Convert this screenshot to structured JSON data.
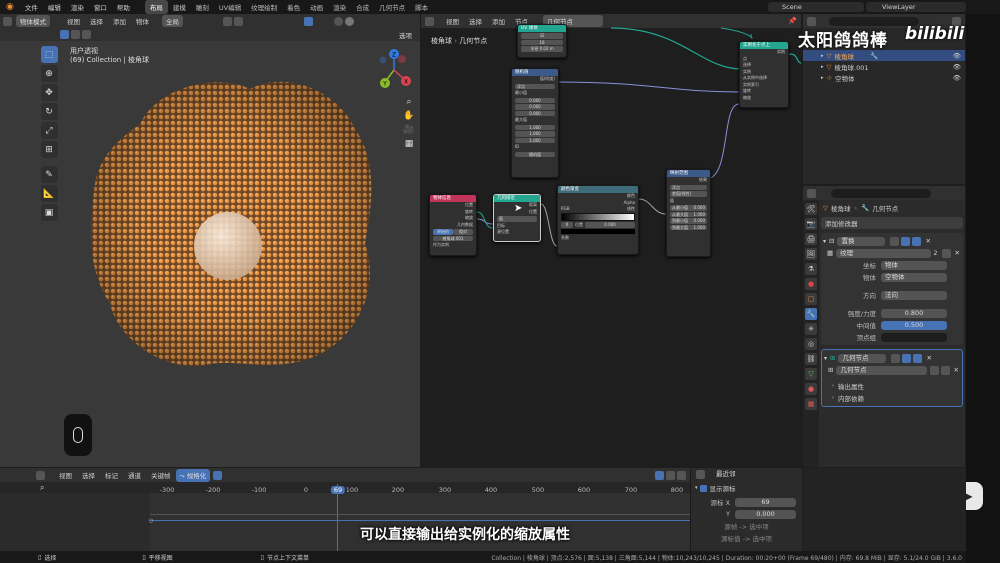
{
  "topbar": {
    "menus": [
      "文件",
      "编辑",
      "渲染",
      "窗口",
      "帮助"
    ],
    "workspaces": [
      "布局",
      "建模",
      "雕刻",
      "UV编辑",
      "纹理绘制",
      "着色",
      "动画",
      "渲染",
      "合成",
      "几何节点",
      "脚本"
    ],
    "active_workspace": "布局",
    "scene": "Scene",
    "view_layer": "ViewLayer"
  },
  "viewport": {
    "mode": "物体模式",
    "menus": [
      "视图",
      "选择",
      "添加",
      "物体"
    ],
    "orientation": "全局",
    "options": "选项",
    "view_title": "用户透视",
    "collection_line": "(69) Collection | 棱角球",
    "gizmo_axes": [
      "Y",
      "Z",
      "X"
    ]
  },
  "node_editor": {
    "menus": [
      "视图",
      "选择",
      "添加",
      "节点"
    ],
    "tree_name": "几何节点",
    "breadcrumb": [
      "棱角球",
      "几何节点"
    ],
    "nodes": {
      "uv": {
        "title": "UV 球体",
        "fields": [
          "32",
          "16",
          "半径  0.02 m"
        ]
      },
      "instance": {
        "title": "实例化于点上",
        "rows": [
          "实例",
          "点",
          "选择",
          "实例",
          "从实例中选择",
          "实例索引",
          "旋转",
          "缩放"
        ]
      },
      "random": {
        "title": "随机值",
        "rows": [
          "值(明度)",
          "浮点",
          "最小值",
          "最大值",
          "ID",
          "种子"
        ],
        "fields": [
          "0.000",
          "0.000",
          "0.000",
          "1.000",
          "1.000",
          "1.000",
          "随机值"
        ]
      },
      "objinfo": {
        "title": "物体信息",
        "rows": [
          "位置",
          "旋转",
          "缩放",
          "几何数据"
        ],
        "toggle": [
          "原始的",
          "相对"
        ],
        "object": "棱角球.001",
        "asinst": "作为实例"
      },
      "distribute": {
        "title": "几何接近",
        "rows": [
          "距离",
          "位置",
          "源",
          "目标",
          "源位置"
        ],
        "menu": "面"
      },
      "colorramp": {
        "title": "颜色渐变",
        "rows": [
          "颜色",
          "Alpha",
          "系数"
        ],
        "mode": "RGB",
        "interp": "线性",
        "pos_label": "位置",
        "pos": "0.000",
        "index": "0"
      },
      "maprange": {
        "title": "映射范围",
        "rows": [
          "结果",
          "浮点",
          "差值(线性)",
          "值",
          "从最小值",
          "从最大值",
          "到最小值",
          "到最大值"
        ],
        "fields": [
          "0.000",
          "1.000",
          "0.000",
          "1.000"
        ]
      }
    }
  },
  "outliner": {
    "items": [
      {
        "name": "棱角球"
      },
      {
        "name": "棱角球.001"
      },
      {
        "name": "空物体"
      }
    ]
  },
  "properties": {
    "header_breadcrumb": [
      "棱角球",
      "几何节点"
    ],
    "add_modifier": "添加修改器",
    "displace": {
      "name": "置换",
      "texture_label": "纹理",
      "texture_count": "2",
      "coords_label": "坐标",
      "coords_value": "物体",
      "object_label": "物体",
      "object_value": "空物体",
      "direction_label": "方向",
      "direction_value": "法向",
      "strength_label": "强度/力度",
      "strength_value": "0.800",
      "midlevel_label": "中间值",
      "midlevel_value": "0.500",
      "vgroup_label": "顶点组"
    },
    "geonodes": {
      "name": "几何节点",
      "tree": "几何节点",
      "output_attrs": "输出属性",
      "internal_deps": "内部依赖"
    }
  },
  "timeline": {
    "menus": [
      "视图",
      "选择",
      "标记",
      "通道",
      "关键帧"
    ],
    "mode": "规格化",
    "ticks": [
      "-300",
      "-200",
      "-100",
      "0",
      "69",
      "100",
      "200",
      "300",
      "400",
      "500",
      "600",
      "700",
      "800"
    ],
    "current_frame": "69",
    "side_panel": {
      "interp": "最近邻",
      "title": "显示源标",
      "x_label": "源标 X",
      "x_value": "69",
      "y_label": "Y",
      "y_value": "0.000",
      "line1": "源帧 -> 选中项",
      "line2": "源标值 -> 选中项"
    }
  },
  "statusbar": {
    "left": "选择",
    "mid": "平移视图",
    "right_hint": "节点上下文菜单",
    "stats": "Collection | 棱角球 | 顶点:2,576 | 面:5,138 | 三角面:5,144 | 物体:10,243/10,245 | Duration: 00:20+00 (Frame 69/480) | 内存: 69.8 MiB | 显存: 5.1/24.0 GiB | 3.6.0"
  },
  "overlay": {
    "subtitle": "可以直接输出给实例化的缩放属性",
    "watermark_text": "太阳鸽鸽棒",
    "logo": "bilibili"
  },
  "colors": {
    "accent": "#4772b3",
    "orange": "#e88c3a",
    "teal": "#23a691",
    "panel": "#2b2b2b"
  }
}
